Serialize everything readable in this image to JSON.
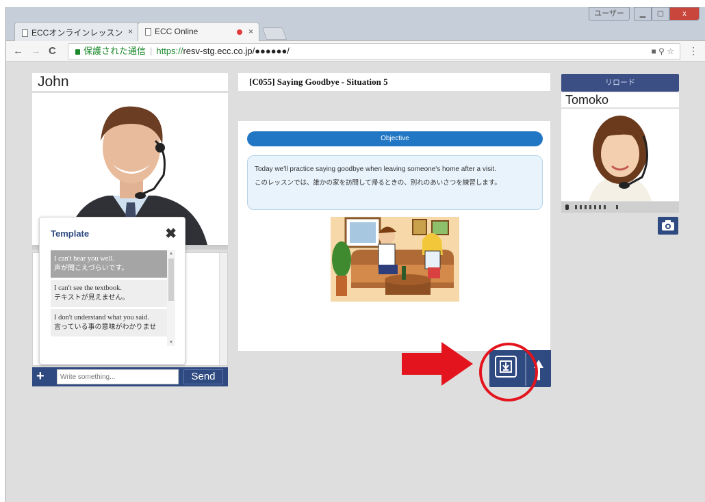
{
  "browser": {
    "tabs": [
      {
        "title": "ECCオンラインレッスン",
        "close": "×"
      },
      {
        "title": "ECC Online",
        "close": "×"
      }
    ],
    "window_user_label": "ユーザー",
    "window_close": "x",
    "address": {
      "secure_label": "保護された通信",
      "separator": "|",
      "url_scheme": "https://",
      "url_rest": "resv-stg.ecc.co.jp/●●●●●●/"
    },
    "nav": {
      "back": "←",
      "forward": "→",
      "reload": "C"
    },
    "omni_icons": "■ ⚲ ☆",
    "menu": "⋮"
  },
  "left": {
    "name": "John",
    "template": {
      "heading": "Template",
      "close": "✖",
      "items": [
        {
          "en": "I can't hear you well.",
          "jp": "声が聞こえづらいです。"
        },
        {
          "en": "I can't see the textbook.",
          "jp": "テキストが見えません。"
        },
        {
          "en": "I don't understand what you said.",
          "jp": "言っている事の意味がわかりませ"
        }
      ]
    },
    "chat": {
      "plus": "+",
      "placeholder": "Write something...",
      "send": "Send"
    }
  },
  "center": {
    "lesson_title": "[C055] Saying Goodbye - Situation 5",
    "objective_label": "Objective",
    "objective_en": "Today we'll practice saying goodbye when leaving someone's home after a visit.",
    "objective_jp": "このレッスンでは、誰かの家を訪問して帰るときの、別れのあいさつを練習します。"
  },
  "right": {
    "reload_label": "リロード",
    "name": "Tomoko"
  },
  "colors": {
    "navy": "#2f4a80",
    "objective_blue": "#2177c4",
    "annotation_red": "#e4141e",
    "page_bg": "#dedede"
  }
}
